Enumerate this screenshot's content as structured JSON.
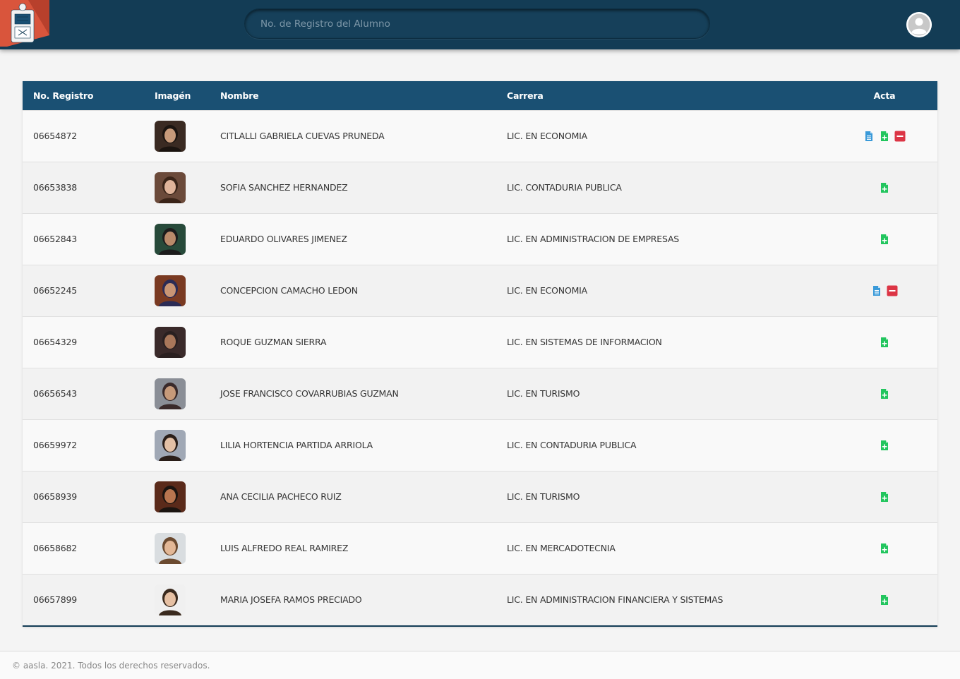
{
  "header": {
    "search": {
      "placeholder": "No. de Registro del Alumno",
      "value": ""
    },
    "logo_icon": "university-seal-icon",
    "user_icon": "user-avatar-icon"
  },
  "table": {
    "columns": [
      "No. Registro",
      "Imagén",
      "Nombre",
      "Carrera",
      "Acta"
    ],
    "rows": [
      {
        "registro": "06654872",
        "nombre": "CITLALLI GABRIELA CUEVAS PRUNEDA",
        "carrera": "LIC. EN ECONOMIA",
        "acta": [
          "view",
          "add",
          "remove"
        ]
      },
      {
        "registro": "06653838",
        "nombre": "SOFIA SANCHEZ HERNANDEZ",
        "carrera": "LIC. CONTADURIA PUBLICA",
        "acta": [
          "add"
        ]
      },
      {
        "registro": "06652843",
        "nombre": "EDUARDO OLIVARES JIMENEZ",
        "carrera": "LIC. EN ADMINISTRACION DE EMPRESAS",
        "acta": [
          "add"
        ]
      },
      {
        "registro": "06652245",
        "nombre": "CONCEPCION CAMACHO LEDON",
        "carrera": "LIC. EN ECONOMIA",
        "acta": [
          "view",
          "remove"
        ]
      },
      {
        "registro": "06654329",
        "nombre": "ROQUE GUZMAN SIERRA",
        "carrera": "LIC. EN SISTEMAS DE INFORMACION",
        "acta": [
          "add"
        ]
      },
      {
        "registro": "06656543",
        "nombre": "JOSE FRANCISCO COVARRUBIAS GUZMAN",
        "carrera": "LIC. EN TURISMO",
        "acta": [
          "add"
        ]
      },
      {
        "registro": "06659972",
        "nombre": "LILIA HORTENCIA PARTIDA ARRIOLA",
        "carrera": "LIC. EN CONTADURIA PUBLICA",
        "acta": [
          "add"
        ]
      },
      {
        "registro": "06658939",
        "nombre": "ANA CECILIA PACHECO RUIZ",
        "carrera": "LIC. EN TURISMO",
        "acta": [
          "add"
        ]
      },
      {
        "registro": "06658682",
        "nombre": "LUIS ALFREDO REAL RAMIREZ",
        "carrera": "LIC. EN MERCADOTECNIA",
        "acta": [
          "add"
        ]
      },
      {
        "registro": "06657899",
        "nombre": "MARIA JOSEFA RAMOS PRECIADO",
        "carrera": "LIC. EN ADMINISTRACION FINANCIERA Y SISTEMAS",
        "acta": [
          "add"
        ]
      }
    ]
  },
  "footer": {
    "text": "© aasla. 2021. Todos los derechos reservados."
  },
  "colors": {
    "header_bg": "#133c55",
    "table_head": "#1a5073",
    "icon_view": "#3a9ad9",
    "icon_add": "#22c55e",
    "icon_remove": "#dc3545"
  }
}
